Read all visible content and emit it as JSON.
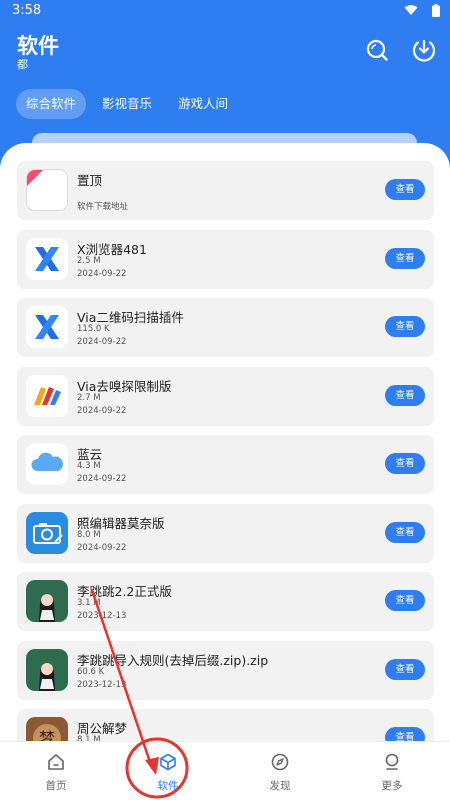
{
  "status_bar": {
    "time": "3:58"
  },
  "header": {
    "title": "软件",
    "subtitle": "都"
  },
  "tabs": [
    {
      "label": "综合软件",
      "active": true
    },
    {
      "label": "影视音乐",
      "active": false
    },
    {
      "label": "游戏人间",
      "active": false
    }
  ],
  "apps": [
    {
      "name": "置顶",
      "size": "",
      "date": "软件下载地址",
      "button": "查看",
      "icon": "pinned-icon"
    },
    {
      "name": "X浏览器481",
      "size": "2.5 M",
      "date": "2024-09-22",
      "button": "查看",
      "icon": "x-browser-icon"
    },
    {
      "name": "Via二维码扫描插件",
      "size": "115.0 K",
      "date": "2024-09-22",
      "button": "查看",
      "icon": "x-browser-icon"
    },
    {
      "name": "Via去嗅探限制版",
      "size": "2.7 M",
      "date": "2024-09-22",
      "button": "查看",
      "icon": "via-icon"
    },
    {
      "name": "蓝云",
      "size": "4.3 M",
      "date": "2024-09-22",
      "button": "查看",
      "icon": "cloud-icon"
    },
    {
      "name": "照编辑器莫奈版",
      "size": "8.0 M",
      "date": "2024-09-22",
      "button": "查看",
      "icon": "camera-icon"
    },
    {
      "name": "李跳跳2.2正式版",
      "size": "3.1 M",
      "date": "2023-12-13",
      "button": "查看",
      "icon": "girl-avatar-icon"
    },
    {
      "name": "李跳跳导入规则(去掉后缀.zip).zip",
      "size": "60.6 K",
      "date": "2023-12-13",
      "button": "查看",
      "icon": "girl-avatar-icon"
    },
    {
      "name": "周公解梦",
      "size": "8.1 M",
      "date": "",
      "button": "查看",
      "icon": "dream-icon"
    }
  ],
  "bottom_nav": [
    {
      "label": "首页",
      "icon": "home-icon",
      "active": false
    },
    {
      "label": "软件",
      "icon": "cube-icon",
      "active": true
    },
    {
      "label": "发现",
      "icon": "compass-icon",
      "active": false
    },
    {
      "label": "更多",
      "icon": "user-icon",
      "active": false
    }
  ],
  "colors": {
    "accent": "#2E7DF1",
    "annotation": "#E8352B"
  }
}
